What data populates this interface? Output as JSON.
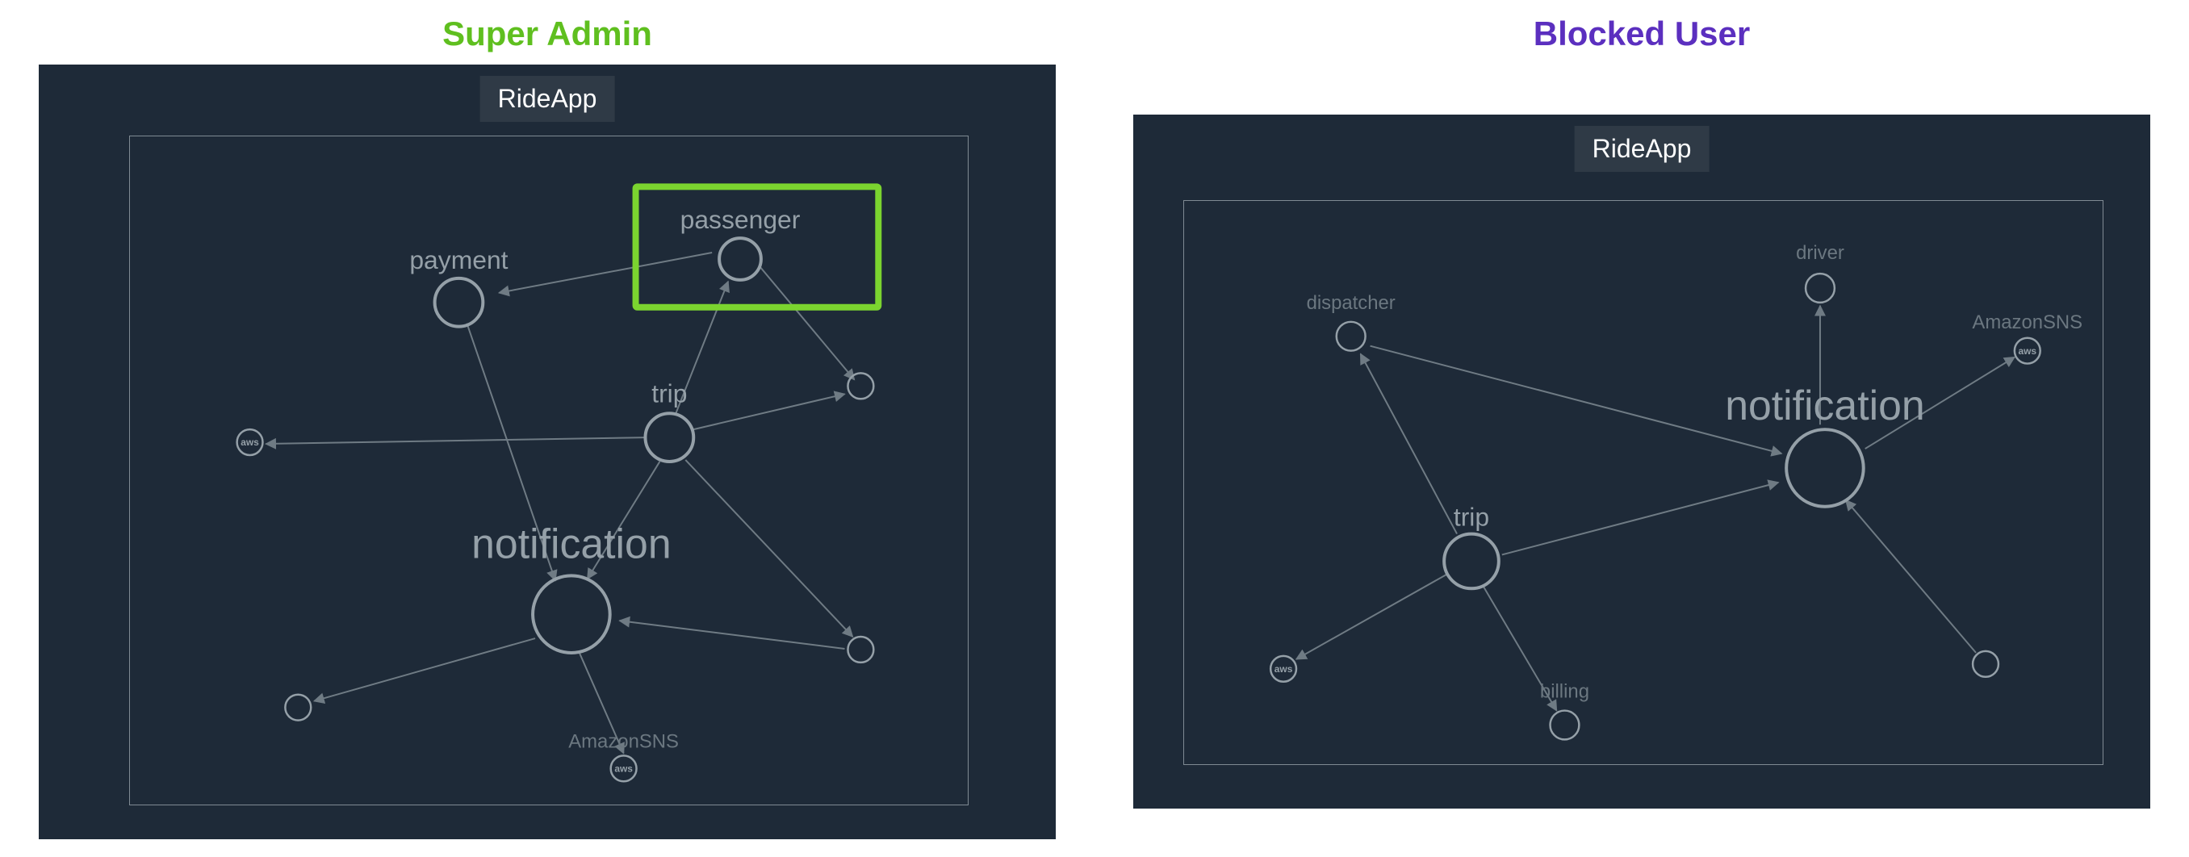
{
  "titles": {
    "admin": "Super Admin",
    "blocked": "Blocked User"
  },
  "app_name": "RideApp",
  "left": {
    "nodes": {
      "passenger": {
        "label": "passenger"
      },
      "payment": {
        "label": "payment"
      },
      "trip": {
        "label": "trip"
      },
      "notification": {
        "label": "notification"
      },
      "amazonsns": {
        "label": "AmazonSNS"
      }
    }
  },
  "right": {
    "nodes": {
      "dispatcher": {
        "label": "dispatcher"
      },
      "driver": {
        "label": "driver"
      },
      "amazonsns": {
        "label": "AmazonSNS"
      },
      "trip": {
        "label": "trip"
      },
      "notification": {
        "label": "notification"
      },
      "billing": {
        "label": "billing"
      }
    }
  },
  "colors": {
    "bg": "#1e2a38",
    "node": "#95a0a8",
    "edge": "#6f7b84",
    "highlight": "#7bd42f",
    "admin_title": "#5fbf1f",
    "blocked_title": "#5b2fbf"
  }
}
